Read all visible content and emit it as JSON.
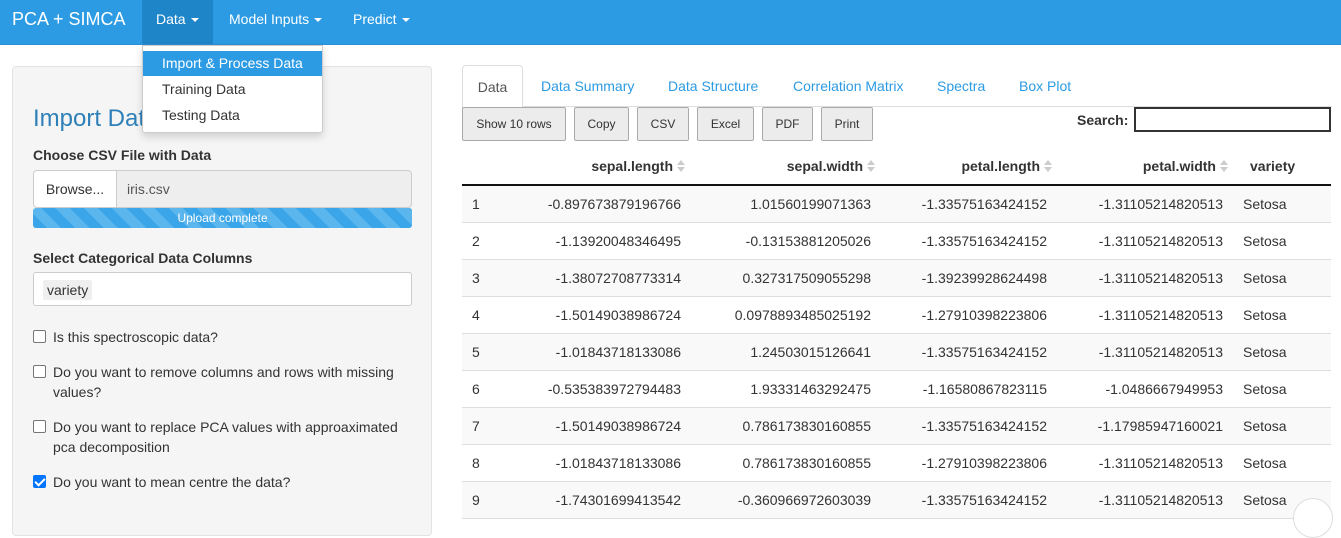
{
  "navbar": {
    "brand": "PCA + SIMCA",
    "items": [
      {
        "label": "Data"
      },
      {
        "label": "Model Inputs"
      },
      {
        "label": "Predict"
      }
    ]
  },
  "dropdown": {
    "items": [
      {
        "label": "Import & Process Data"
      },
      {
        "label": "Training Data"
      },
      {
        "label": "Testing Data"
      }
    ]
  },
  "sidebar": {
    "title": "Import Data",
    "file_label": "Choose CSV File with Data",
    "browse_label": "Browse...",
    "file_value": "iris.csv",
    "progress_text": "Upload complete",
    "progress_value": 1.0,
    "cat_label": "Select Categorical Data Columns",
    "cat_selected": "variety",
    "checkboxes": [
      {
        "label": "Is this spectroscopic data?",
        "checked": false
      },
      {
        "label": "Do you want to remove columns and rows with missing values?",
        "checked": false
      },
      {
        "label": "Do you want to replace PCA values with approaximated pca decomposition",
        "checked": false
      },
      {
        "label": "Do you want to mean centre the data?",
        "checked": true
      }
    ]
  },
  "tabs": [
    {
      "label": "Data"
    },
    {
      "label": "Data Summary"
    },
    {
      "label": "Data Structure"
    },
    {
      "label": "Correlation Matrix"
    },
    {
      "label": "Spectra"
    },
    {
      "label": "Box Plot"
    }
  ],
  "buttons": [
    {
      "label": "Show 10 rows"
    },
    {
      "label": "Copy"
    },
    {
      "label": "CSV"
    },
    {
      "label": "Excel"
    },
    {
      "label": "PDF"
    },
    {
      "label": "Print"
    }
  ],
  "search": {
    "label": "Search:",
    "value": ""
  },
  "table": {
    "columns": [
      "",
      "sepal.length",
      "sepal.width",
      "petal.length",
      "petal.width",
      "variety"
    ],
    "rows": [
      [
        "1",
        "-0.897673879196766",
        "1.01560199071363",
        "-1.33575163424152",
        "-1.31105214820513",
        "Setosa"
      ],
      [
        "2",
        "-1.13920048346495",
        "-0.13153881205026",
        "-1.33575163424152",
        "-1.31105214820513",
        "Setosa"
      ],
      [
        "3",
        "-1.38072708773314",
        "0.327317509055298",
        "-1.39239928624498",
        "-1.31105214820513",
        "Setosa"
      ],
      [
        "4",
        "-1.50149038986724",
        "0.0978893485025192",
        "-1.27910398223806",
        "-1.31105214820513",
        "Setosa"
      ],
      [
        "5",
        "-1.01843718133086",
        "1.24503015126641",
        "-1.33575163424152",
        "-1.31105214820513",
        "Setosa"
      ],
      [
        "6",
        "-0.535383972794483",
        "1.93331463292475",
        "-1.16580867823115",
        "-1.0486667949953",
        "Setosa"
      ],
      [
        "7",
        "-1.50149038986724",
        "0.786173830160855",
        "-1.33575163424152",
        "-1.17985947160021",
        "Setosa"
      ],
      [
        "8",
        "-1.01843718133086",
        "0.786173830160855",
        "-1.27910398223806",
        "-1.31105214820513",
        "Setosa"
      ],
      [
        "9",
        "-1.74301699413542",
        "-0.360966972603039",
        "-1.33575163424152",
        "-1.31105214820513",
        "Setosa"
      ]
    ]
  }
}
